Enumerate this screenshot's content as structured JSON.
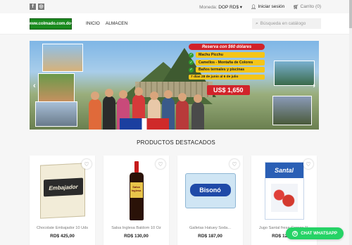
{
  "topbar": {
    "social": [
      {
        "icon": "facebook-icon",
        "glyph": "f"
      },
      {
        "icon": "instagram-icon",
        "glyph": "◎"
      }
    ],
    "currency_label": "Moneda:",
    "currency_value": "DOP RD$",
    "login_label": "Iniciar sesión",
    "cart_label": "Carrito",
    "cart_count": "(0)"
  },
  "header": {
    "logo_text": "www.colmado.com.do+",
    "nav": [
      "INICIO",
      "ALMACEN"
    ],
    "search_placeholder": "Búsqueda en catálogo"
  },
  "banner": {
    "headline": "Reserva con $60 dólares",
    "items": [
      "Machu Picchu",
      "Camellos - Montaña de Colores",
      "Baños termales y piscinas"
    ],
    "dates": "7 días  28 de junio al 6 de julio",
    "price": "US$ 1,650"
  },
  "section_title": "PRODUCTOS DESTACADOS",
  "products": [
    {
      "name": "Chocolate Embajador 10 Uds",
      "price": "RD$ 425,00",
      "brand": "Embajador"
    },
    {
      "name": "Salsa Inglesa Baldom 10 Oz",
      "price": "RD$ 130,00",
      "brand": "Salsa Inglesa"
    },
    {
      "name": "Galletas Hatuey Soda...",
      "price": "RD$ 187,00",
      "brand": "Bisonó"
    },
    {
      "name": "Jugo Santal fresa-Cereza 1L",
      "price": "RD$ 126,00",
      "brand": "Santal"
    }
  ],
  "chat_label": "CHAT WHATSAPP",
  "colors": {
    "accent": "#d1232a",
    "whatsapp": "#25d366",
    "logo": "#1a8a1e"
  }
}
